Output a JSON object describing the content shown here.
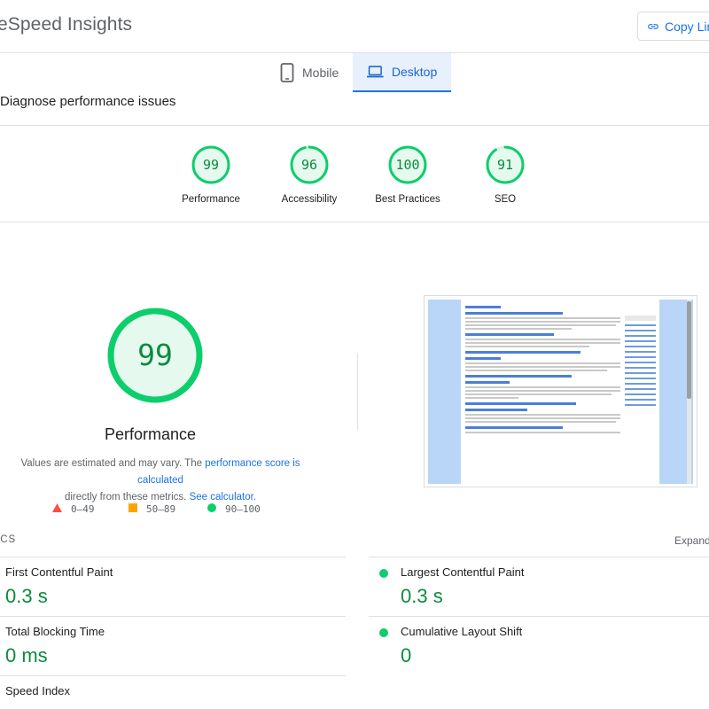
{
  "header": {
    "title": "eSpeed Insights",
    "copy_link": "Copy Lin"
  },
  "tabs": [
    {
      "label": "Mobile",
      "active": false
    },
    {
      "label": "Desktop",
      "active": true
    }
  ],
  "section_title": "Diagnose performance issues",
  "scores": [
    {
      "label": "Performance",
      "value": "99",
      "score": 0.99
    },
    {
      "label": "Accessibility",
      "value": "96",
      "score": 0.96
    },
    {
      "label": "Best Practices",
      "value": "100",
      "score": 1.0
    },
    {
      "label": "SEO",
      "value": "91",
      "score": 0.91
    }
  ],
  "main_gauge": {
    "value": "99",
    "label": "Performance",
    "score": 0.99
  },
  "note": {
    "prefix": "Values are estimated and may vary. The ",
    "link1": "performance score is calculated",
    "middle": "directly from these metrics. ",
    "link2": "See calculator."
  },
  "legend": [
    {
      "range": "0–49",
      "color": "#ff4e42",
      "shape": "triangle"
    },
    {
      "range": "50–89",
      "color": "#ffa400",
      "shape": "square"
    },
    {
      "range": "90–100",
      "color": "#0cce6b",
      "shape": "circle"
    }
  ],
  "metrics_heading": "ICS",
  "expand_label": "Expand",
  "metrics": [
    {
      "name": "First Contentful Paint",
      "value": "0.3 s"
    },
    {
      "name": "Largest Contentful Paint",
      "value": "0.3 s"
    },
    {
      "name": "Total Blocking Time",
      "value": "0 ms"
    },
    {
      "name": "Cumulative Layout Shift",
      "value": "0"
    },
    {
      "name": "Speed Index",
      "value": ""
    }
  ],
  "colors": {
    "pass": "#0cce6b",
    "pass_text": "#0c8a3e",
    "accent": "#1a73e8"
  }
}
